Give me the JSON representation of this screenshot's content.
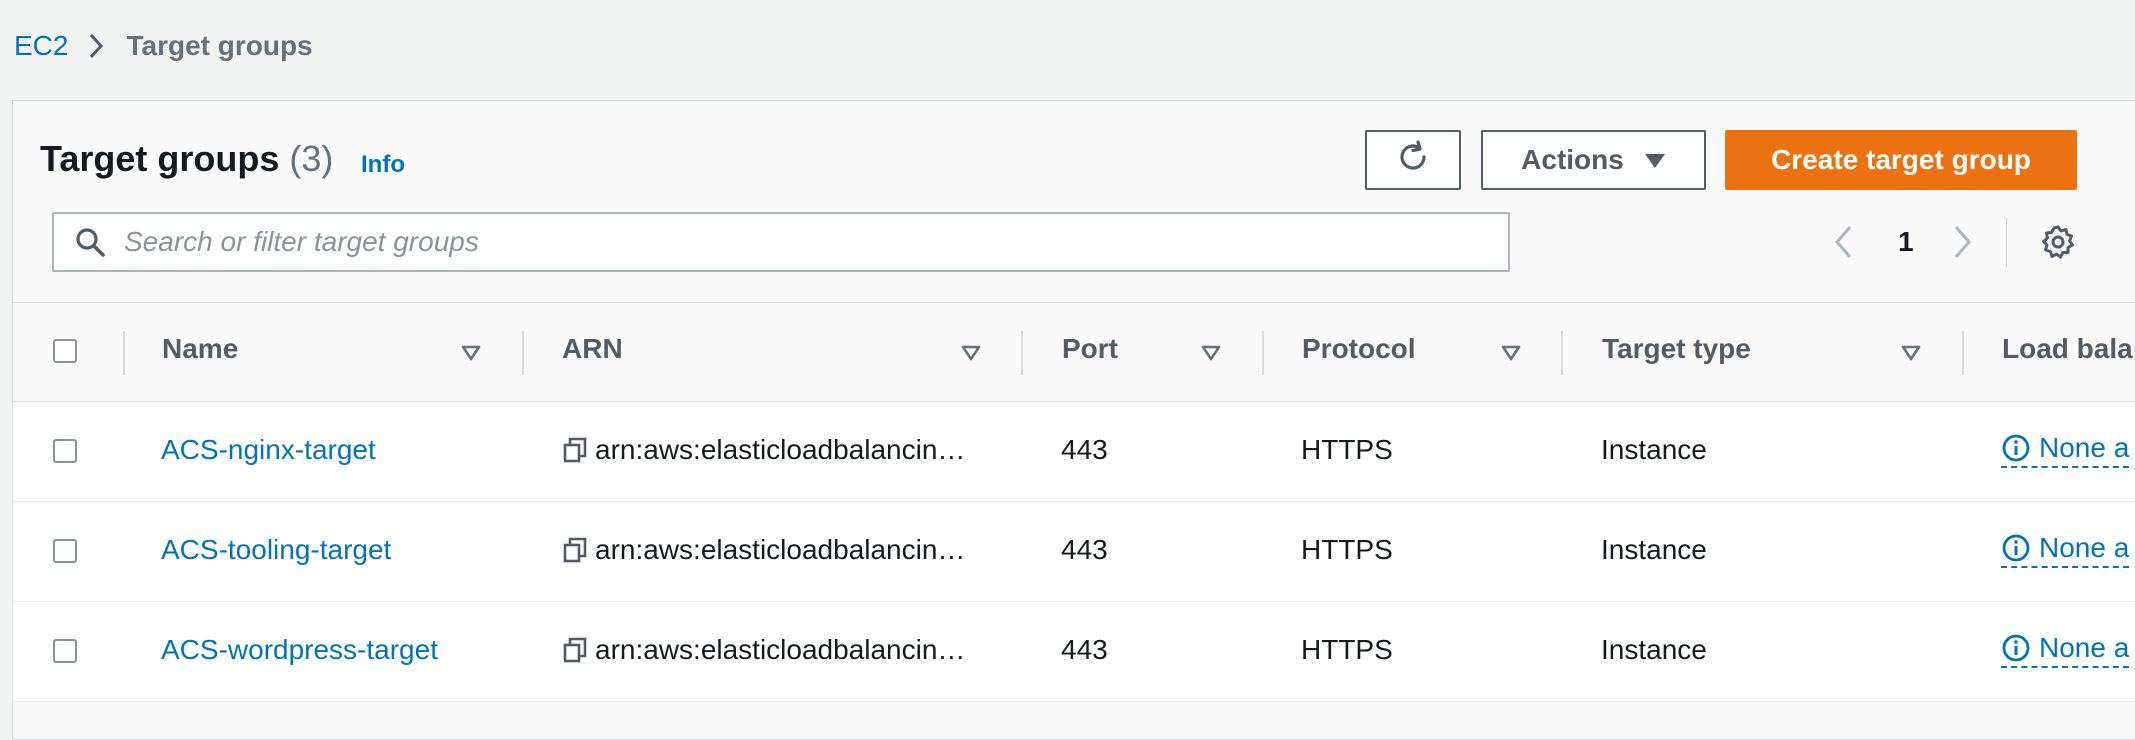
{
  "breadcrumb": {
    "parent": "EC2",
    "current": "Target groups"
  },
  "header": {
    "title": "Target groups",
    "count": "(3)",
    "info": "Info"
  },
  "toolbar": {
    "actions_label": "Actions",
    "create_label": "Create target group"
  },
  "search": {
    "placeholder": "Search or filter target groups",
    "value": ""
  },
  "pagination": {
    "current_page": "1"
  },
  "table": {
    "columns": [
      "Name",
      "ARN",
      "Port",
      "Protocol",
      "Target type",
      "Load bala"
    ],
    "rows": [
      {
        "name": "ACS-nginx-target",
        "arn": "arn:aws:elasticloadbalancin…",
        "port": "443",
        "protocol": "HTTPS",
        "target_type": "Instance",
        "load_balancer": "None a"
      },
      {
        "name": "ACS-tooling-target",
        "arn": "arn:aws:elasticloadbalancin…",
        "port": "443",
        "protocol": "HTTPS",
        "target_type": "Instance",
        "load_balancer": "None a"
      },
      {
        "name": "ACS-wordpress-target",
        "arn": "arn:aws:elasticloadbalancin…",
        "port": "443",
        "protocol": "HTTPS",
        "target_type": "Instance",
        "load_balancer": "None a"
      }
    ]
  },
  "icons": {
    "breadcrumb_separator": "chevron-right-icon",
    "refresh": "refresh-icon",
    "actions_caret": "caret-down-icon",
    "search": "search-icon",
    "prev": "chevron-left-icon",
    "next": "chevron-right-icon",
    "settings": "gear-icon",
    "sort": "sort-triangle-icon",
    "copy": "copy-icon",
    "info": "info-circle-icon"
  },
  "colors": {
    "accent": "#ec7211",
    "link": "#0073bb",
    "text": "#16191f",
    "muted": "#545b64"
  }
}
